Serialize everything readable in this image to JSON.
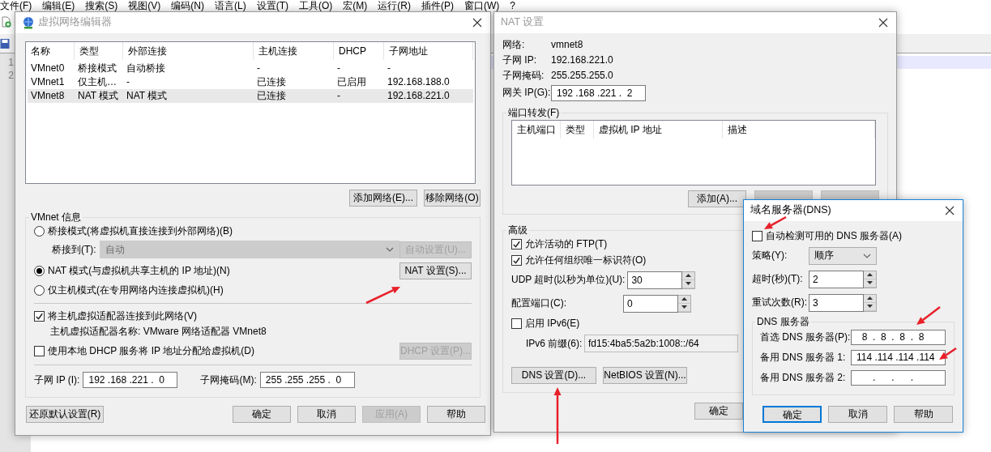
{
  "editor": {
    "menu": [
      "文件(F)",
      "编辑(E)",
      "搜索(S)",
      "视图(V)",
      "编码(N)",
      "语言(L)",
      "设置(T)",
      "工具(O)",
      "宏(M)",
      "运行(R)",
      "插件(P)",
      "窗口(W)",
      "?"
    ],
    "line_numbers": [
      "1",
      "2"
    ]
  },
  "network_editor": {
    "title": "虚拟网络编辑器",
    "active": false,
    "columns": [
      "名称",
      "类型",
      "外部连接",
      "主机连接",
      "DHCP",
      "子网地址"
    ],
    "rows": [
      {
        "cells": [
          "VMnet0",
          "桥接模式",
          "自动桥接",
          "-",
          "-",
          "-"
        ],
        "selected": false
      },
      {
        "cells": [
          "VMnet1",
          "仅主机…",
          "-",
          "已连接",
          "已启用",
          "192.168.188.0"
        ],
        "selected": false
      },
      {
        "cells": [
          "VMnet8",
          "NAT 模式",
          "NAT 模式",
          "已连接",
          "-",
          "192.168.221.0"
        ],
        "selected": true
      }
    ],
    "list_buttons": [
      {
        "label": "添加网络(E)...",
        "disabled": false
      },
      {
        "label": "移除网络(O)",
        "disabled": false
      }
    ],
    "group_title": "VMnet 信息",
    "modes": [
      {
        "label": "桥接模式(将虚拟机直接连接到外部网络)(B)",
        "selected": false
      },
      {
        "label": "NAT 模式(与虚拟机共享主机的 IP 地址)(N)",
        "selected": true
      },
      {
        "label": "仅主机模式(在专用网络内连接虚拟机)(H)",
        "selected": false
      }
    ],
    "bridge": {
      "label": "桥接到(T):",
      "value": "自动",
      "disabled": true
    },
    "auto_button": {
      "label": "自动设置(U)...",
      "disabled": true
    },
    "nat_button": {
      "label": "NAT 设置(S)...",
      "disabled": false
    },
    "connect_adapter": {
      "label": "将主机虚拟适配器连接到此网络(V)",
      "checked": true
    },
    "adapter_name": "主机虚拟适配器名称: VMware 网络适配器 VMnet8",
    "use_dhcp": {
      "label": "使用本地 DHCP 服务将 IP 地址分配给虚拟机(D)",
      "checked": false
    },
    "dhcp_button": {
      "label": "DHCP 设置(P)...",
      "disabled": true
    },
    "subnet_ip": {
      "label": "子网 IP (I):",
      "value": "192 .168 .221 .  0"
    },
    "subnet_mask": {
      "label": "子网掩码(M):",
      "value": "255 .255 .255 .  0"
    },
    "buttons": [
      {
        "label": "还原默认设置(R)",
        "disabled": false
      },
      {
        "label": "确定",
        "disabled": false
      },
      {
        "label": "取消",
        "disabled": false
      },
      {
        "label": "应用(A)",
        "disabled": true
      },
      {
        "label": "帮助",
        "disabled": false
      }
    ]
  },
  "nat_settings": {
    "title": "NAT 设置",
    "active": false,
    "info": [
      {
        "label": "网络:",
        "value": "vmnet8"
      },
      {
        "label": "子网 IP:",
        "value": "192.168.221.0"
      },
      {
        "label": "子网掩码:",
        "value": "255.255.255.0"
      }
    ],
    "gateway": {
      "label": "网关 IP(G):",
      "value": "192 .168 .221 .  2"
    },
    "forwarding_title": "端口转发(F)",
    "forwarding_columns": [
      "主机端口",
      "类型",
      "虚拟机 IP 地址",
      "描述"
    ],
    "forwarding_buttons": [
      {
        "label": "添加(A)...",
        "disabled": false
      },
      {
        "disabled": true
      },
      {
        "disabled": true
      }
    ],
    "advanced_title": "高级",
    "options": [
      {
        "kind": "checkbox",
        "label": "允许活动的 FTP(T)",
        "checked": true
      },
      {
        "kind": "checkbox",
        "label": "允许任何组织唯一标识符(O)",
        "checked": true
      },
      {
        "kind": "spinner",
        "label": "UDP 超时(以秒为单位)(U):",
        "value": "30"
      },
      {
        "kind": "spinner",
        "label": "配置端口(C):",
        "value": "0"
      },
      {
        "kind": "checkbox",
        "label": "启用 IPv6(E)",
        "checked": false
      },
      {
        "kind": "field",
        "label": "IPv6 前缀(6):",
        "value": "fd15:4ba5:5a2b:1008::/64",
        "disabled": true
      }
    ],
    "advanced_buttons": [
      {
        "label": "DNS 设置(D)...",
        "disabled": false
      },
      {
        "label": "NetBIOS 设置(N)...",
        "disabled": false
      }
    ],
    "buttons": [
      {
        "label": "确定",
        "disabled": false
      }
    ]
  },
  "dns": {
    "title": "域名服务器(DNS)",
    "active": true,
    "auto_detect": {
      "label": "自动检测可用的 DNS 服务器(A)",
      "checked": false
    },
    "settings": [
      {
        "kind": "select",
        "label": "策略(Y):",
        "value": "顺序"
      },
      {
        "kind": "spinner",
        "label": "超时(秒)(T):",
        "value": "2"
      },
      {
        "kind": "spinner",
        "label": "重试次数(R):",
        "value": "3"
      }
    ],
    "servers_title": "DNS 服务器",
    "servers": [
      {
        "label": "首选 DNS 服务器(P):",
        "value": "  8  .  8  .  8  .  8"
      },
      {
        "label": "备用 DNS 服务器 1:",
        "value": "114 .114 .114 .114"
      },
      {
        "label": "备用 DNS 服务器 2:",
        "value": "      .      .      ."
      }
    ],
    "buttons": [
      {
        "label": "确定",
        "default": true
      },
      {
        "label": "取消",
        "default": false
      },
      {
        "label": "帮助",
        "default": false
      }
    ]
  }
}
